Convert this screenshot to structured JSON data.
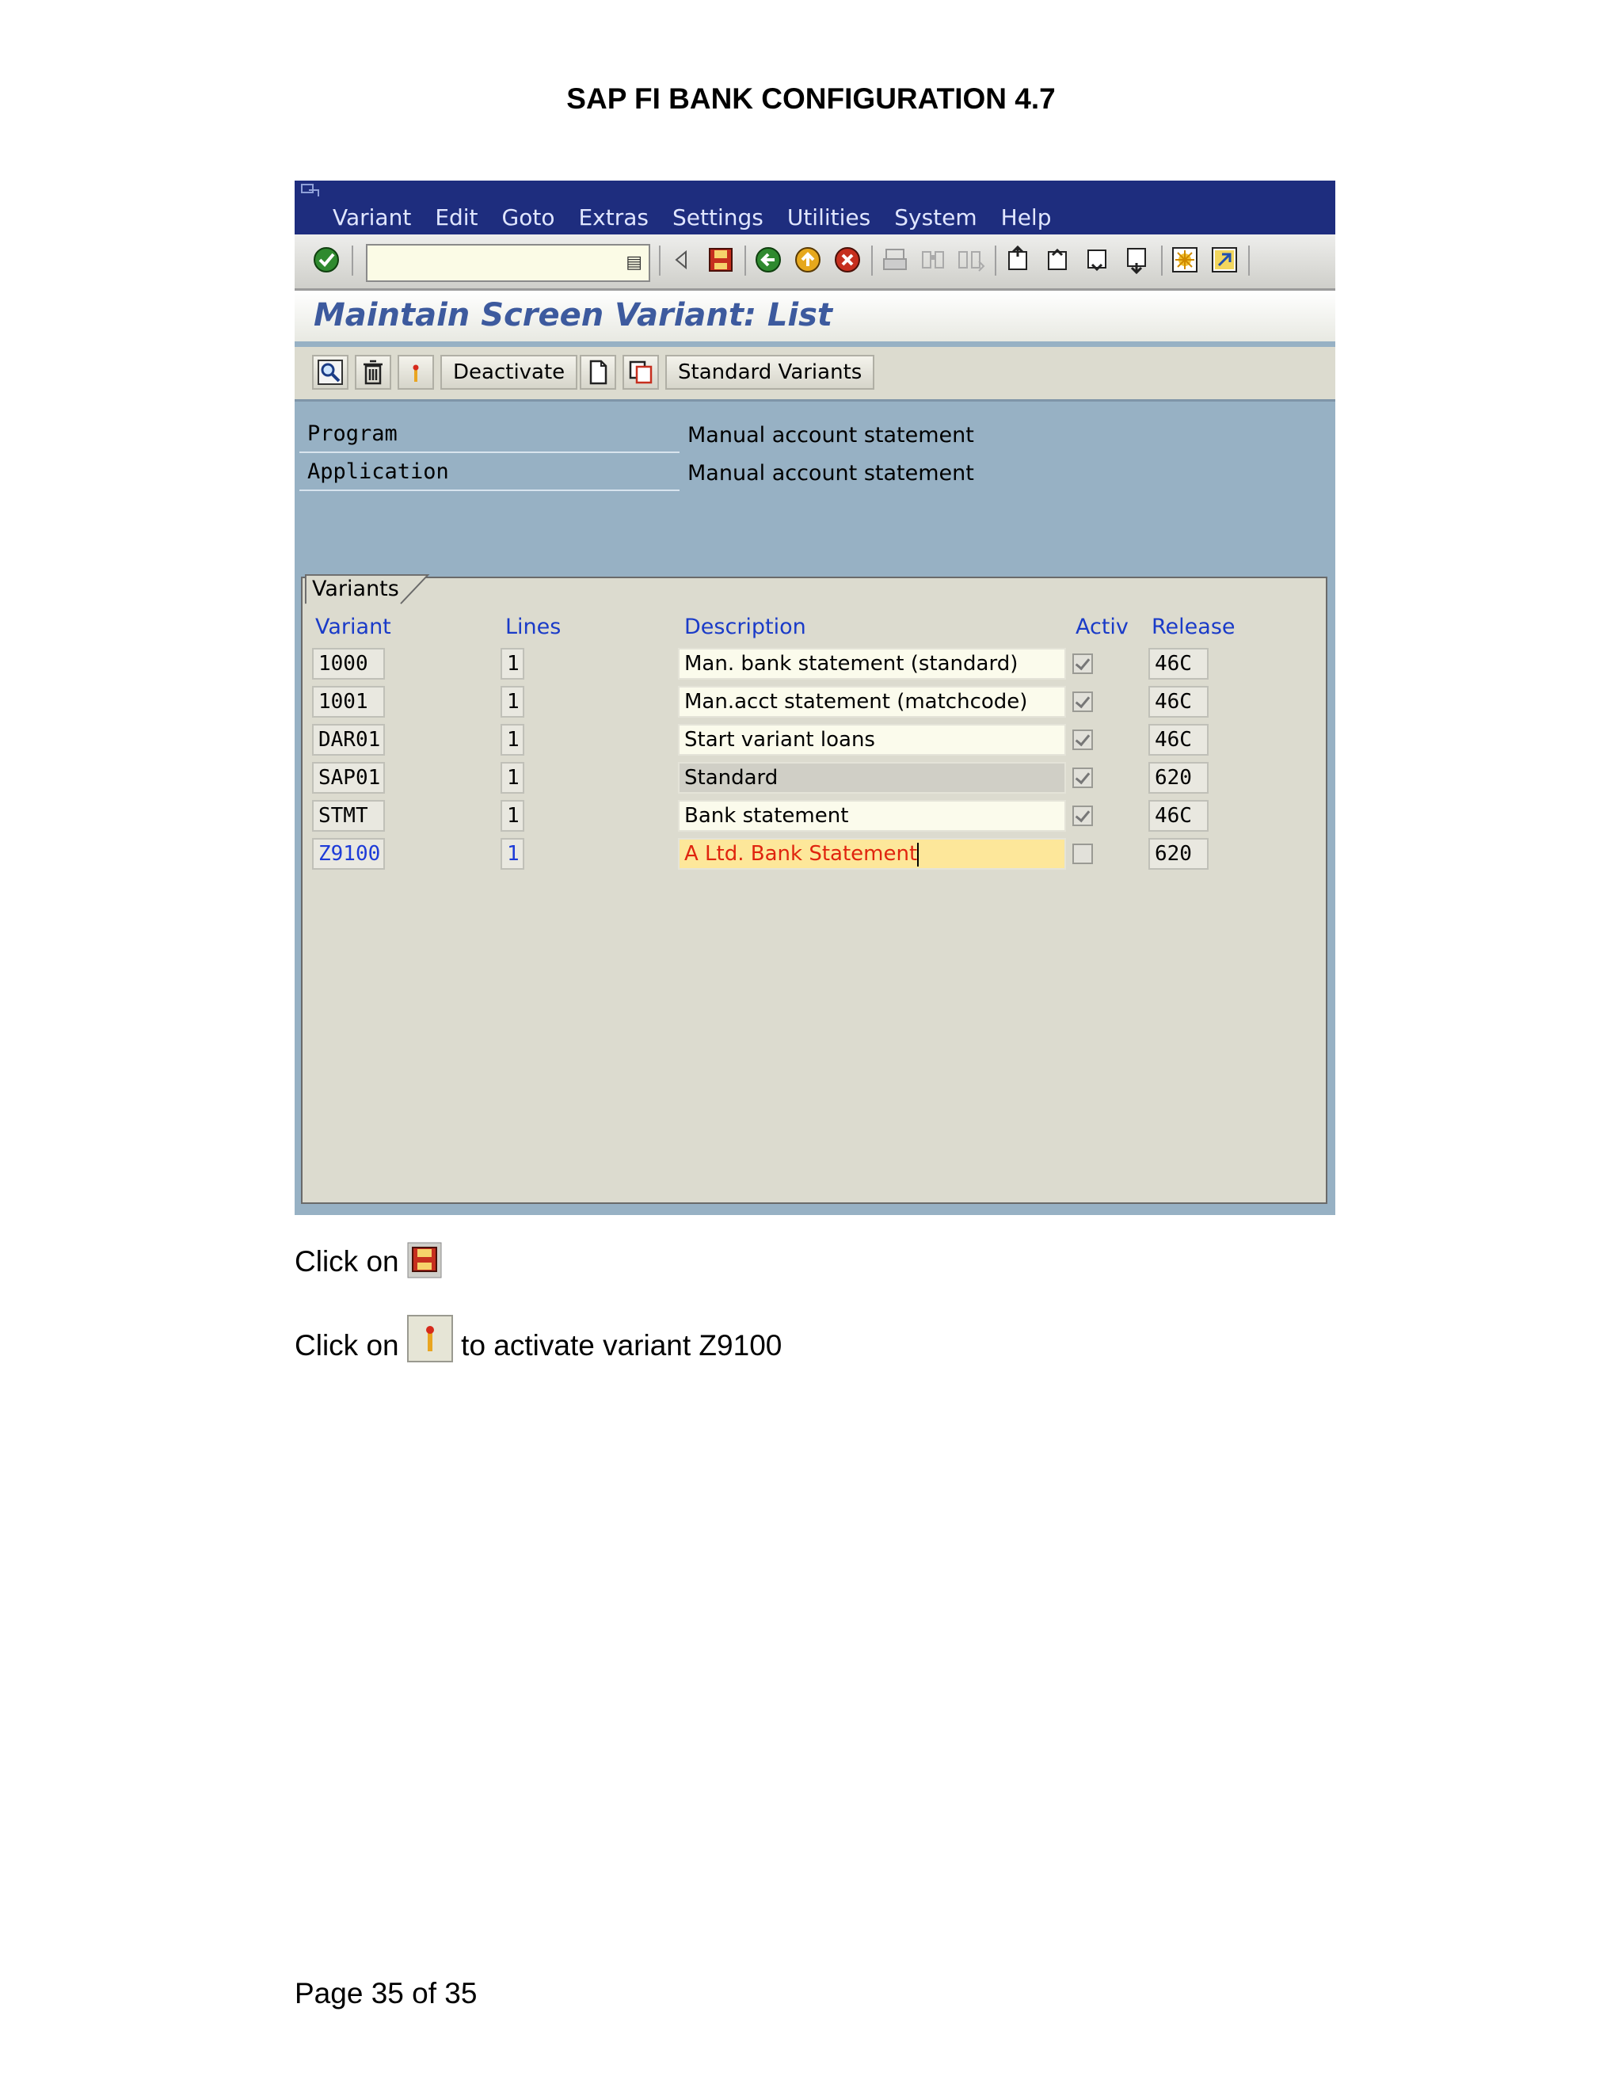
{
  "document": {
    "title": "SAP FI BANK CONFIGURATION 4.7",
    "footer": "Page 35 of 35"
  },
  "sap_window": {
    "menu": [
      "Variant",
      "Edit",
      "Goto",
      "Extras",
      "Settings",
      "Utilities",
      "System",
      "Help"
    ],
    "screen_title": "Maintain Screen Variant: List",
    "app_toolbar": {
      "deactivate_label": "Deactivate",
      "standard_variants_label": "Standard Variants"
    },
    "fields": {
      "program_label": "Program",
      "program_value": "Manual account statement",
      "application_label": "Application",
      "application_value": "Manual account statement"
    },
    "variants_tab": "Variants",
    "columns": {
      "variant": "Variant",
      "lines": "Lines",
      "description": "Description",
      "activ": "Activ",
      "release": "Release"
    },
    "rows": [
      {
        "variant": "1000",
        "lines": "1",
        "description": "Man. bank statement (standard)",
        "active": true,
        "release": "46C"
      },
      {
        "variant": "1001",
        "lines": "1",
        "description": "Man.acct statement (matchcode)",
        "active": true,
        "release": "46C"
      },
      {
        "variant": "DAR01",
        "lines": "1",
        "description": "Start variant loans",
        "active": true,
        "release": "46C"
      },
      {
        "variant": "SAP01",
        "lines": "1",
        "description": "Standard",
        "active": true,
        "release": "620"
      },
      {
        "variant": "STMT",
        "lines": "1",
        "description": "Bank statement",
        "active": true,
        "release": "46C"
      },
      {
        "variant": "Z9100",
        "lines": "1",
        "description": "A Ltd. Bank Statement",
        "active": false,
        "release": "620"
      }
    ]
  },
  "instructions": {
    "line1_prefix": "Click on",
    "line2_prefix": "Click on",
    "line2_suffix": "to activate variant Z9100"
  },
  "icons": [
    "save-icon",
    "activate-icon",
    "check-icon",
    "back-icon",
    "exit-icon",
    "cancel-icon",
    "print-icon",
    "find-icon",
    "delete-icon",
    "create-icon",
    "copy-icon"
  ],
  "colors": {
    "title_bar": "#1e2d7e",
    "screen_bg": "#97b1c4",
    "column_header": "#1a3bc8",
    "edit_field": "#fde79a",
    "edit_text": "#e0240e"
  }
}
